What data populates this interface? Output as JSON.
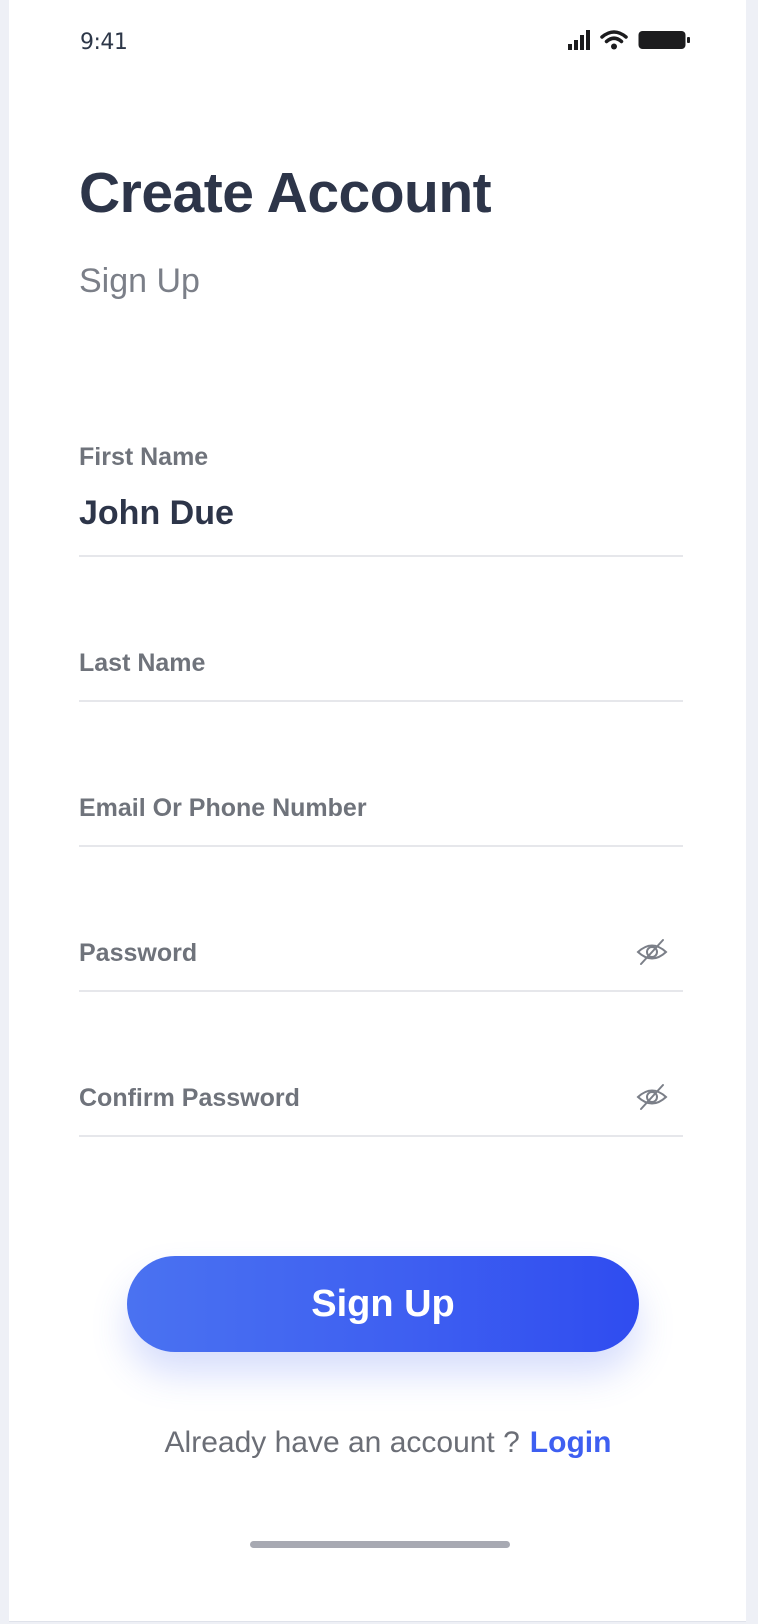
{
  "status_bar": {
    "time": "9:41",
    "icons": [
      "signal-icon",
      "wifi-icon",
      "battery-icon"
    ]
  },
  "header": {
    "title": "Create Account",
    "subtitle": "Sign Up"
  },
  "form": {
    "first_name": {
      "label": "First Name",
      "value": "John Due"
    },
    "last_name": {
      "label": "Last Name",
      "value": ""
    },
    "contact": {
      "label": "Email Or Phone Number",
      "value": ""
    },
    "password": {
      "label": "Password",
      "value": "",
      "icon": "eye-off-icon"
    },
    "confirm_password": {
      "label": "Confirm Password",
      "value": "",
      "icon": "eye-off-icon"
    }
  },
  "actions": {
    "signup_label": "Sign Up"
  },
  "footer": {
    "prompt": "Already have an account ?",
    "login_label": "Login"
  },
  "colors": {
    "accent": "#3e5ff1",
    "title_text": "#2d3549",
    "label_text": "#6f737b",
    "divider": "#e6e7eb"
  }
}
